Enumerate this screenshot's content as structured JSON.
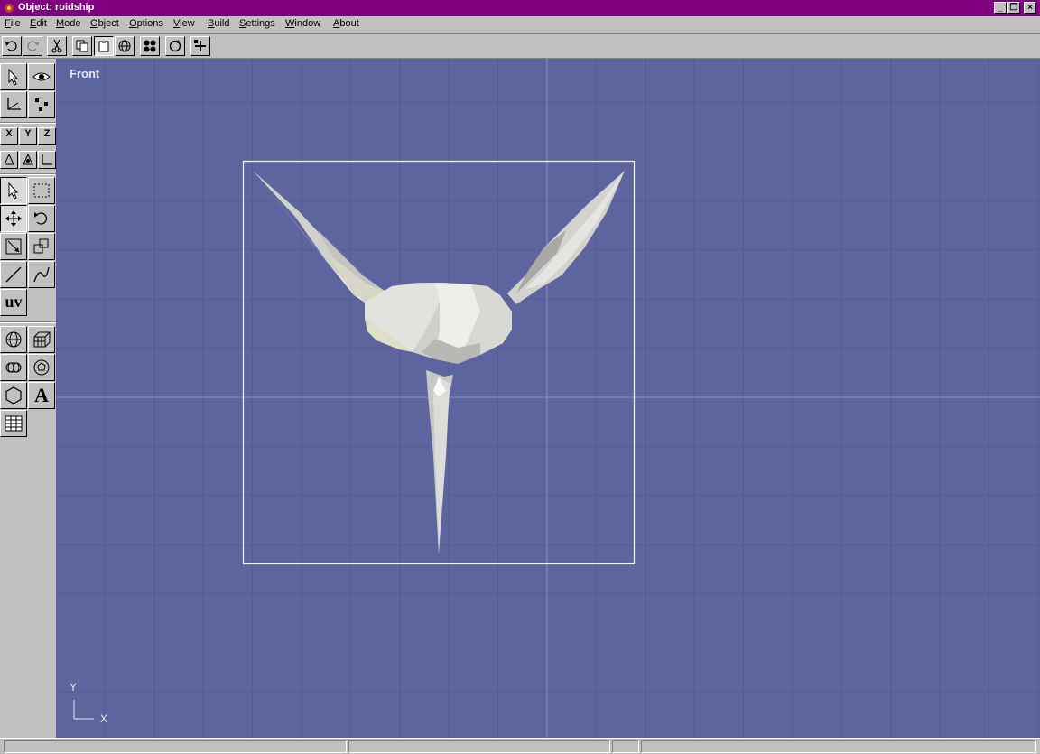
{
  "window": {
    "title": "Object: roidship"
  },
  "menu": [
    {
      "label": "File",
      "acc": "F",
      "rest": "ile"
    },
    {
      "label": "Edit",
      "acc": "E",
      "rest": "dit"
    },
    {
      "label": "Mode",
      "acc": "M",
      "rest": "ode"
    },
    {
      "label": "Object",
      "acc": "O",
      "rest": "bject"
    },
    {
      "label": "Options",
      "acc": "O",
      "rest": "ptions"
    },
    {
      "label": "View",
      "acc": "V",
      "rest": "iew"
    },
    {
      "label": "Build",
      "acc": "B",
      "rest": "uild"
    },
    {
      "label": "Settings",
      "acc": "S",
      "rest": "ettings"
    },
    {
      "label": "Window",
      "acc": "W",
      "rest": "indow"
    },
    {
      "label": "About",
      "acc": "A",
      "rest": "bout"
    }
  ],
  "toolbar_icons": [
    "undo-icon",
    "redo-icon",
    "scissors-icon",
    "copy-icon",
    "paste-icon",
    "sphere-icon",
    "dots-icon",
    "refresh-icon",
    "plus-icon"
  ],
  "palette": {
    "axis_x": "X",
    "axis_y": "Y",
    "axis_z": "Z",
    "uv_label": "uv",
    "text_label": "A"
  },
  "viewport": {
    "label": "Front",
    "axis_y": "Y",
    "axis_x": "X",
    "background": "#5e659e",
    "grid_color": "#555b91"
  },
  "colors": {
    "titlebar": "#800080"
  }
}
